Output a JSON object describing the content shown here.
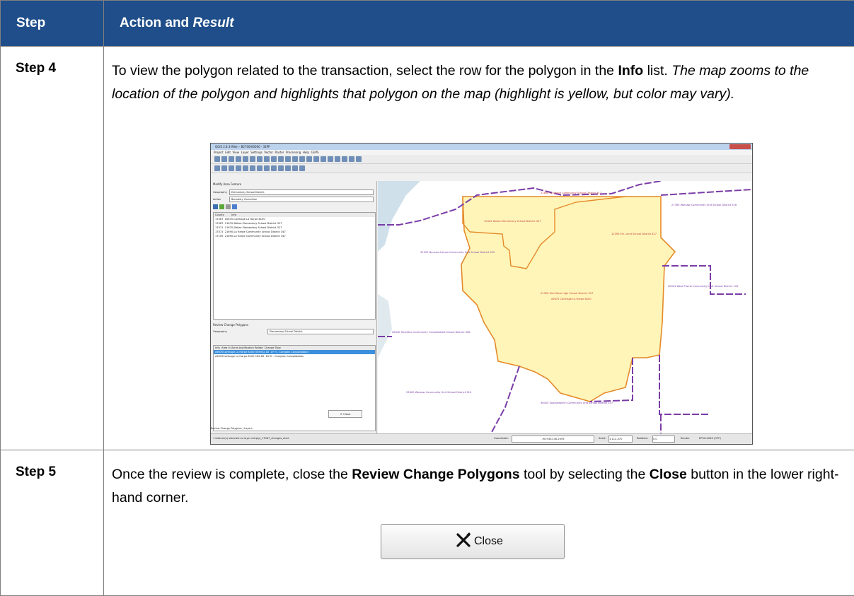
{
  "header": {
    "col1": "Step",
    "col2_prefix": "Action and ",
    "col2_italic": "Result"
  },
  "rows": [
    {
      "step": "Step 4",
      "line1_a": "To view the polygon related to the transaction, select the row for the polygon in the ",
      "line1_b": "Info",
      "line1_c": " list.",
      "result": "The map zooms to the location of the polygon and highlights that polygon on the map (highlight is yellow, but color may vary)."
    },
    {
      "step": "Step 5",
      "a": "Once the review is complete, close the ",
      "b": "Review Change Polygons",
      "c": " tool by selecting the ",
      "d": "Close",
      "e": " button in the lower right-hand corner."
    }
  ],
  "close_button": {
    "label": "Close",
    "icon": "x-icon"
  },
  "screenshot": {
    "title": "QGIS 2.8.3-Wien - B2700/00000 - 32PP",
    "menus": [
      "Project",
      "Edit",
      "View",
      "Layer",
      "Settings",
      "Vector",
      "Raster",
      "Processing",
      "Help",
      "GUPS"
    ],
    "modify_panel_title": "Modify Area Feature",
    "geography_label": "Geography",
    "geography_value": "Elementary School District",
    "action_label": "Action",
    "action_value": "Boundary Correction",
    "info_headers": [
      "County",
      "Info"
    ],
    "info_rows": [
      [
        "17067",
        "a5670-Carthage La Harpe 8100"
      ],
      [
        "17067",
        "11670-Dallas Elementary School District 327"
      ],
      [
        "17071",
        "11670-Dallas Elementary School District 327"
      ],
      [
        "17071",
        "21690-La Harpe Community School District 347"
      ],
      [
        "17109",
        "21690-La Harpe Community School District 347"
      ]
    ],
    "review_panel_title": "Review Change Polygons",
    "review_geography_label": "Geography",
    "review_geography_value": "Elementary School District",
    "review_headers": [
      "Info",
      "Area in Acres",
      "Justification",
      "Relate",
      "Change Type"
    ],
    "review_rows": [
      [
        "a5670Carthage La Harpe 8100",
        "555932.18",
        "",
        "1Y",
        "H - Complex Consolidation"
      ],
      [
        "a5670Carthage La Harpe 8100",
        "162.65",
        "",
        "1N",
        "H - Complex Consolidation"
      ]
    ],
    "mini_close": "Close",
    "bottom_tabs": [
      "Review Change Polygons",
      "Layers"
    ],
    "status_left": "1 feature(s) selected on layer edcplyl_17067_changes_eled.",
    "coordinate_label": "Coordinate:",
    "coordinate_value": "-90.9352,40.2093",
    "scale_label": "Scale",
    "scale_value": "1:112,470",
    "rotation_label": "Rotation:",
    "rotation_value": "0.0",
    "render_label": "Render",
    "crs_label": "EPSG:4269 (OTF)",
    "map_labels": [
      "21690 La Harpe Community School District 347",
      "10325 Dallas Elementary School District 327",
      "11670 Dallas Elementary School District 327",
      "12390 Elv...land School District 327",
      "27390 Warsaw Community Unit School District 316",
      "31320 Nauvoo-Colusa Community Unit School District 325",
      "01326 Illini West High School District 307",
      "a5670 Carthage La Harpe 8100",
      "28440 Hamilton Community Consolidated School District 328",
      "00024 West Prairie Community Unit School District 103",
      "23400 Warsaw Community Unit School District 316",
      "36420 Southeastern Community Unit School District 337"
    ]
  }
}
